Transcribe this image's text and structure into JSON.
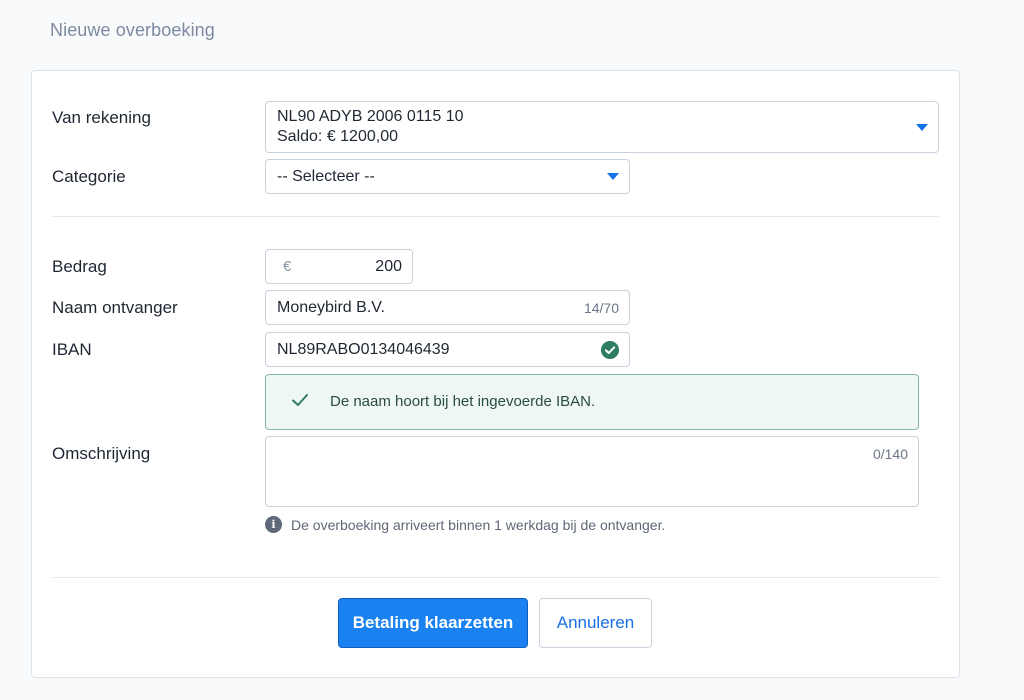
{
  "page": {
    "title": "Nieuwe overboeking"
  },
  "form": {
    "from_account": {
      "label": "Van rekening",
      "iban": "NL90 ADYB 2006 0115 10",
      "balance": "Saldo: € 1200,00"
    },
    "category": {
      "label": "Categorie",
      "value": "-- Selecteer --"
    },
    "amount": {
      "label": "Bedrag",
      "currency": "€",
      "value": "200"
    },
    "recipient_name": {
      "label": "Naam ontvanger",
      "value": "Moneybird B.V.",
      "counter": "14/70"
    },
    "iban": {
      "label": "IBAN",
      "value": "NL89RABO0134046439",
      "valid_icon": "check-circle-icon"
    },
    "name_check": {
      "message": "De naam hoort bij het ingevoerde IBAN.",
      "icon": "checkmark-icon"
    },
    "description": {
      "label": "Omschrijving",
      "value": "",
      "counter": "0/140"
    },
    "info": {
      "icon": "info-icon",
      "text": "De overboeking arriveert binnen 1 werkdag bij de ontvanger."
    }
  },
  "actions": {
    "submit_label": "Betaling klaarzetten",
    "cancel_label": "Annuleren"
  },
  "colors": {
    "accent": "#1a82f0",
    "success": "#2e7d61",
    "success_bg": "#eef7f3"
  }
}
